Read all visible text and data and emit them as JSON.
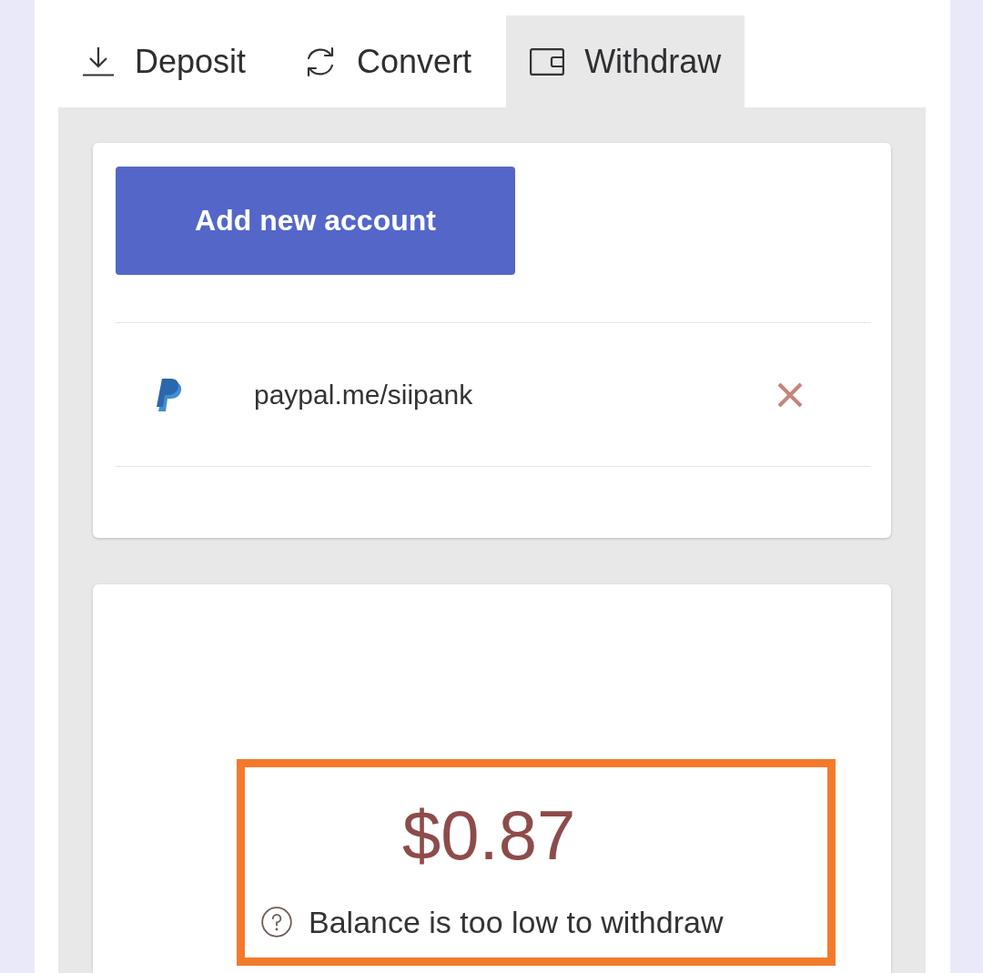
{
  "tabs": [
    {
      "kind": "deposit",
      "label": "Deposit",
      "selected": false
    },
    {
      "kind": "convert",
      "label": "Convert",
      "selected": false
    },
    {
      "kind": "withdraw",
      "label": "Withdraw",
      "selected": true
    }
  ],
  "accounts_card": {
    "add_button": "Add new account",
    "accounts": [
      {
        "kind": "paypal",
        "address": "paypal.me/siipank"
      }
    ]
  },
  "balance": {
    "amount": "$0.87",
    "note": "Balance is too low to withdraw",
    "highlighted": true
  }
}
